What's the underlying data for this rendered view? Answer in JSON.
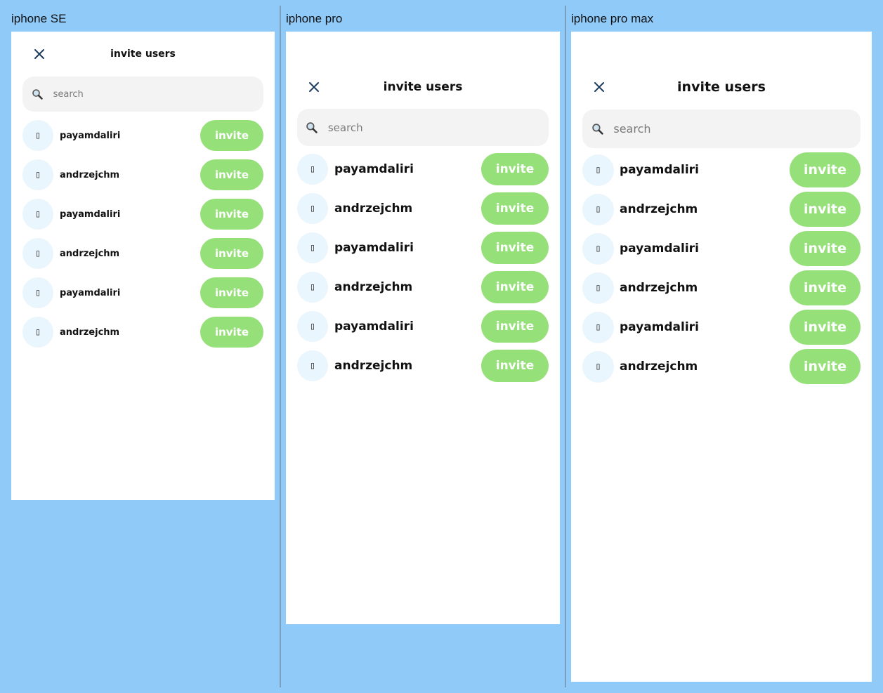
{
  "frames": [
    {
      "label": "iphone SE",
      "title": "invite users",
      "search_placeholder": "search",
      "users": [
        {
          "avatar": "▯",
          "name": "payamdaliri",
          "button": "invite"
        },
        {
          "avatar": "▯",
          "name": "andrzejchm",
          "button": "invite"
        },
        {
          "avatar": "▯",
          "name": "payamdaliri",
          "button": "invite"
        },
        {
          "avatar": "▯",
          "name": "andrzejchm",
          "button": "invite"
        },
        {
          "avatar": "▯",
          "name": "payamdaliri",
          "button": "invite"
        },
        {
          "avatar": "▯",
          "name": "andrzejchm",
          "button": "invite"
        }
      ]
    },
    {
      "label": "iphone pro",
      "title": "invite users",
      "search_placeholder": "search",
      "users": [
        {
          "avatar": "▯",
          "name": "payamdaliri",
          "button": "invite"
        },
        {
          "avatar": "▯",
          "name": "andrzejchm",
          "button": "invite"
        },
        {
          "avatar": "▯",
          "name": "payamdaliri",
          "button": "invite"
        },
        {
          "avatar": "▯",
          "name": "andrzejchm",
          "button": "invite"
        },
        {
          "avatar": "▯",
          "name": "payamdaliri",
          "button": "invite"
        },
        {
          "avatar": "▯",
          "name": "andrzejchm",
          "button": "invite"
        }
      ]
    },
    {
      "label": "iphone pro max",
      "title": "invite users",
      "search_placeholder": "search",
      "users": [
        {
          "avatar": "▯",
          "name": "payamdaliri",
          "button": "invite"
        },
        {
          "avatar": "▯",
          "name": "andrzejchm",
          "button": "invite"
        },
        {
          "avatar": "▯",
          "name": "payamdaliri",
          "button": "invite"
        },
        {
          "avatar": "▯",
          "name": "andrzejchm",
          "button": "invite"
        },
        {
          "avatar": "▯",
          "name": "payamdaliri",
          "button": "invite"
        },
        {
          "avatar": "▯",
          "name": "andrzejchm",
          "button": "invite"
        }
      ]
    }
  ],
  "icons": {
    "close": "close-icon",
    "search": "search-icon",
    "avatar": "avatar-placeholder-icon"
  },
  "colors": {
    "canvas_background": "#90caf9",
    "invite_button": "#96e07a",
    "search_background": "#f3f3f3",
    "avatar_background": "#eaf6fd",
    "close_icon": "#1f3b5c"
  }
}
